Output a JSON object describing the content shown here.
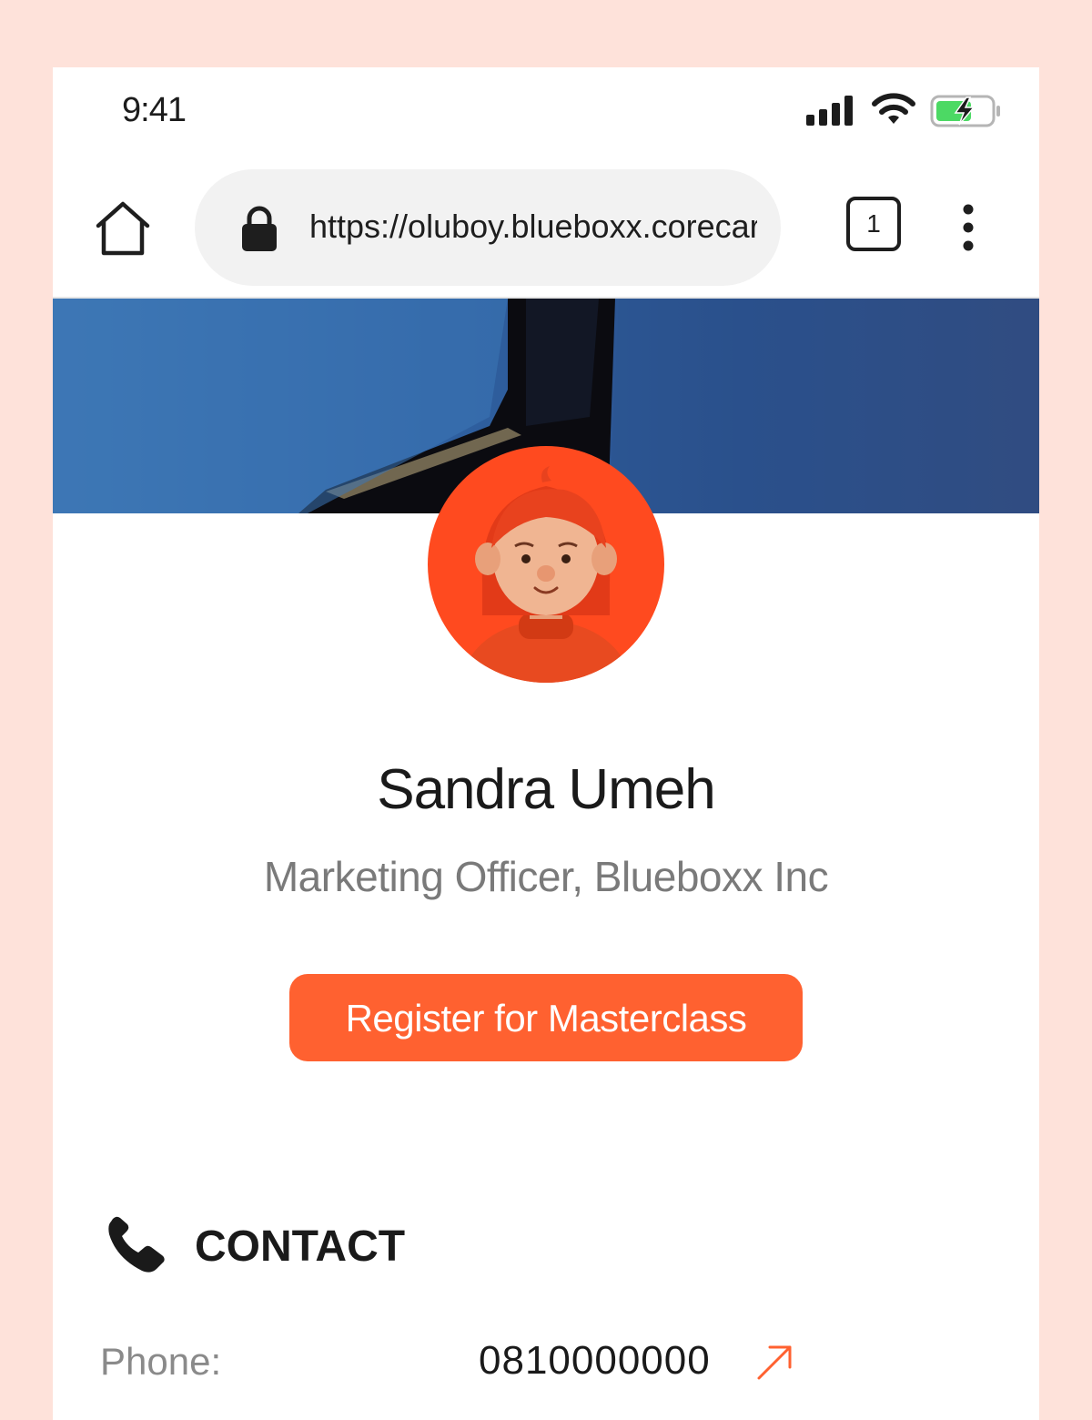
{
  "status_bar": {
    "time": "9:41",
    "icons": [
      "signal-icon",
      "wifi-icon",
      "battery-charging-icon"
    ]
  },
  "browser": {
    "url": "https://oluboy.blueboxx.corecard",
    "tab_count": "1",
    "icons": [
      "home-icon",
      "lock-icon",
      "more-vertical-icon"
    ]
  },
  "profile": {
    "name": "Sandra Umeh",
    "title": "Marketing Officer, Blueboxx Inc",
    "cta_label": "Register for Masterclass"
  },
  "contact": {
    "heading": "CONTACT",
    "rows": [
      {
        "label": "Phone:",
        "value": "0810000000"
      }
    ]
  },
  "colors": {
    "background": "#FEE2DA",
    "accent": "#FF6130",
    "avatar_bg": "#FF4A1F",
    "battery_green": "#4CD964"
  }
}
